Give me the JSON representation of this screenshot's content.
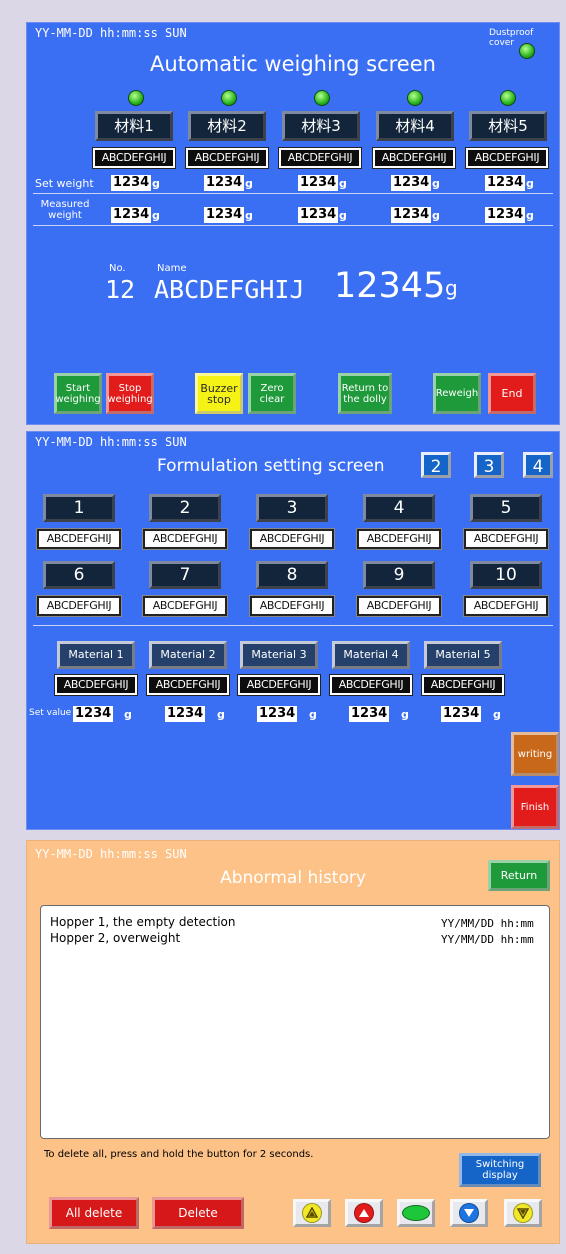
{
  "weighing": {
    "datetime": "YY-MM-DD hh:mm:ss SUN",
    "dustproof_label": "Dustproof cover",
    "title": "Automatic weighing screen",
    "materials": [
      {
        "label": "材料1",
        "name": "ABCDEFGHIJ",
        "set": "1234",
        "measured": "1234"
      },
      {
        "label": "材料2",
        "name": "ABCDEFGHIJ",
        "set": "1234",
        "measured": "1234"
      },
      {
        "label": "材料3",
        "name": "ABCDEFGHIJ",
        "set": "1234",
        "measured": "1234"
      },
      {
        "label": "材料4",
        "name": "ABCDEFGHIJ",
        "set": "1234",
        "measured": "1234"
      },
      {
        "label": "材料5",
        "name": "ABCDEFGHIJ",
        "set": "1234",
        "measured": "1234"
      }
    ],
    "unit": "g",
    "set_weight_label": "Set weight",
    "measured_weight_label": "Measured weight",
    "no_label": "No.",
    "no_value": "12",
    "name_label": "Name",
    "name_value": "ABCDEFGHIJ",
    "total_value": "12345",
    "total_unit": "g",
    "buttons": {
      "start": "Start weighing",
      "stop": "Stop weighing",
      "buzzer": "Buzzer stop",
      "zero": "Zero clear",
      "return_dolly": "Return to the dolly",
      "reweigh": "Reweigh",
      "end": "End"
    },
    "colors": {
      "panel": "#3b6ff3",
      "lamp": "#29b51e"
    }
  },
  "formulation": {
    "datetime": "YY-MM-DD hh:mm:ss SUN",
    "title": "Formulation setting screen",
    "page_buttons": [
      "2",
      "3",
      "4"
    ],
    "recipes": [
      {
        "num": "1",
        "name": "ABCDEFGHIJ"
      },
      {
        "num": "2",
        "name": "ABCDEFGHIJ"
      },
      {
        "num": "3",
        "name": "ABCDEFGHIJ"
      },
      {
        "num": "4",
        "name": "ABCDEFGHIJ"
      },
      {
        "num": "5",
        "name": "ABCDEFGHIJ"
      },
      {
        "num": "6",
        "name": "ABCDEFGHIJ"
      },
      {
        "num": "7",
        "name": "ABCDEFGHIJ"
      },
      {
        "num": "8",
        "name": "ABCDEFGHIJ"
      },
      {
        "num": "9",
        "name": "ABCDEFGHIJ"
      },
      {
        "num": "10",
        "name": "ABCDEFGHIJ"
      }
    ],
    "materials": [
      {
        "label": "Material 1",
        "name": "ABCDEFGHIJ",
        "value": "1234"
      },
      {
        "label": "Material 2",
        "name": "ABCDEFGHIJ",
        "value": "1234"
      },
      {
        "label": "Material 3",
        "name": "ABCDEFGHIJ",
        "value": "1234"
      },
      {
        "label": "Material 4",
        "name": "ABCDEFGHIJ",
        "value": "1234"
      },
      {
        "label": "Material 5",
        "name": "ABCDEFGHIJ",
        "value": "1234"
      }
    ],
    "set_value_label": "Set value",
    "unit": "g",
    "writing_label": "writing",
    "finish_label": "Finish"
  },
  "history": {
    "datetime": "YY-MM-DD hh:mm:ss SUN",
    "title": "Abnormal history",
    "return_label": "Return",
    "entries": [
      {
        "text": "Hopper 1, the empty detection",
        "time": "YY/MM/DD hh:mm"
      },
      {
        "text": "Hopper 2, overweight",
        "time": "YY/MM/DD hh:mm"
      }
    ],
    "hint": "To delete all, press and hold the button for 2 seconds.",
    "switch_label": "Switching display",
    "all_delete_label": "All delete",
    "delete_label": "Delete",
    "nav_icons": [
      "scroll-top-icon",
      "page-up-icon",
      "center-icon",
      "page-down-icon",
      "scroll-bottom-icon"
    ],
    "colors": {
      "panel": "#fcc287"
    }
  }
}
